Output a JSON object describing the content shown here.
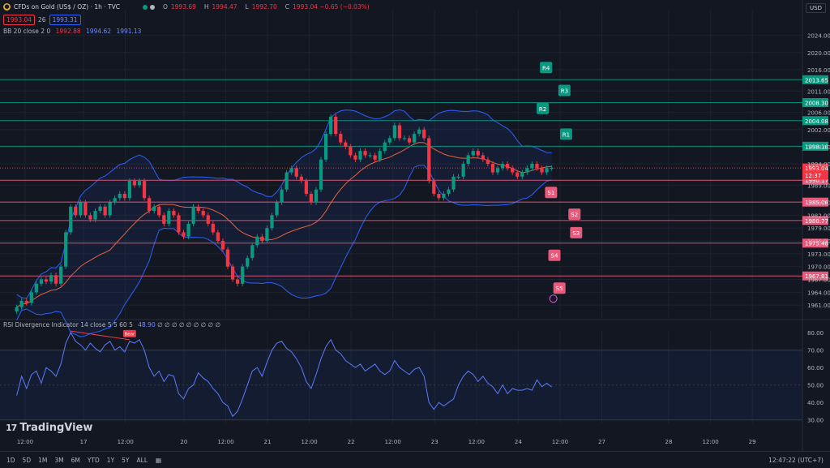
{
  "header": {
    "symbol_title": "CFDs on Gold (US$ / OZ) · 1h · TVC",
    "ohlc": [
      {
        "k": "O",
        "v": "1993.69"
      },
      {
        "k": "H",
        "v": "1994.47"
      },
      {
        "k": "L",
        "v": "1992.70"
      },
      {
        "k": "C",
        "v": "1993.04 −0.65 (−0.03%)"
      }
    ],
    "sell_price": "1993.04",
    "spread": "26",
    "buy_price": "1993.31",
    "bb_label": "BB 20 close 2 0",
    "bb_basis": "1992.88",
    "bb_upper": "1994.62",
    "bb_lower": "1991.13",
    "rsi_label": "RSI Divergence Indicator 14 close 5 5 60 5",
    "rsi_value": "48.90",
    "rsi_tail": "∅ ∅ ∅ ∅ ∅ ∅ ∅ ∅ ∅",
    "currency": "USD"
  },
  "branding": {
    "logo_text": "TradingView",
    "logo_mark": "17"
  },
  "bottom_bar": {
    "ranges": [
      "1D",
      "5D",
      "1M",
      "3M",
      "6M",
      "YTD",
      "1Y",
      "5Y",
      "ALL"
    ],
    "clock": "12:47:22 (UTC+7)"
  },
  "chart_data": {
    "type": "candlestick",
    "title": "CFDs on Gold (US$ / OZ) · 1h · TVC",
    "y_ticks": [
      "2024.00",
      "2020.00",
      "2016.00",
      "2011.00",
      "2006.00",
      "2002.00",
      "1998.00",
      "1994.00",
      "1989.00",
      "1985.00",
      "1982.00",
      "1979.00",
      "1976.00",
      "1973.00",
      "1970.00",
      "1967.00",
      "1964.00",
      "1961.00"
    ],
    "ylim": [
      1958,
      2030
    ],
    "x_tick_labels": [
      "12:00",
      "17",
      "12:00",
      "20",
      "12:00",
      "21",
      "12:00",
      "22",
      "12:00",
      "23",
      "12:00",
      "24",
      "12:00",
      "27",
      "28",
      "12:00",
      "29"
    ],
    "x_tick_positions": [
      0.5,
      4,
      6.5,
      10,
      12.5,
      15,
      17.5,
      20,
      22.5,
      25,
      27.5,
      30,
      32.5,
      35,
      39,
      41.5,
      44
    ],
    "xlim": [
      -1,
      47
    ],
    "last_price": {
      "value": 1993.04,
      "time": "12:37"
    },
    "pivots": [
      {
        "name": "R4",
        "value": 2013.65,
        "color": "#089981"
      },
      {
        "name": "R3",
        "value": 2008.3,
        "color": "#089981"
      },
      {
        "name": "R2",
        "value": 2004.08,
        "color": "#089981"
      },
      {
        "name": "R1",
        "value": 1998.1,
        "color": "#089981"
      },
      {
        "name": "S1",
        "value": 1990.17,
        "color": "#e75a7c"
      },
      {
        "name": "S2",
        "value": 1985.06,
        "color": "#e75a7c"
      },
      {
        "name": "S3",
        "value": 1980.77,
        "color": "#e75a7c"
      },
      {
        "name": "S4",
        "value": 1975.48,
        "color": "#e75a7c"
      },
      {
        "name": "S5",
        "value": 1967.81,
        "color": "#e75a7c"
      }
    ],
    "pivot_label_x": [
      31.3,
      32.4,
      31.1,
      32.5,
      31.6,
      33.0,
      33.1,
      31.8,
      32.1
    ],
    "close": [
      1960.5,
      1962,
      1961.5,
      1964,
      1966,
      1967,
      1966.5,
      1968,
      1966,
      1970,
      1978,
      1984,
      1982,
      1985,
      1982,
      1981,
      1983,
      1984,
      1982,
      1985,
      1986,
      1987,
      1986,
      1990,
      1989,
      1990,
      1986,
      1983,
      1984,
      1982,
      1980,
      1983,
      1982,
      1978,
      1977,
      1980,
      1984,
      1983,
      1982,
      1980,
      1978,
      1976,
      1974,
      1970,
      1967,
      1966,
      1970,
      1972,
      1975,
      1977,
      1976,
      1979,
      1982,
      1985,
      1988,
      1992,
      1993,
      1991,
      1990,
      1987,
      1985,
      1988,
      1995,
      2001,
      2005,
      2001,
      1999,
      1998,
      1996,
      1995,
      1997,
      1996,
      1996,
      1995,
      1997,
      1999,
      2000,
      2003,
      2000,
      2000,
      1999,
      2001,
      2002,
      2000,
      1990,
      1987,
      1986,
      1987,
      1988,
      1991,
      1991,
      1994,
      1996,
      1997,
      1996,
      1995,
      1994,
      1992,
      1993,
      1994,
      1993,
      1992,
      1991,
      1992,
      1993,
      1994,
      1993,
      1992,
      1993,
      1993.04
    ],
    "rsi": {
      "values": [
        44,
        55,
        48,
        56,
        58,
        51,
        60,
        58,
        55,
        62,
        74,
        80,
        75,
        73,
        70,
        74,
        71,
        69,
        73,
        75,
        70,
        72,
        69,
        75,
        74,
        76,
        70,
        60,
        55,
        58,
        52,
        56,
        55,
        45,
        42,
        48,
        50,
        57,
        54,
        52,
        48,
        45,
        40,
        38,
        32,
        35,
        42,
        50,
        58,
        60,
        55,
        63,
        70,
        74,
        75,
        71,
        69,
        65,
        60,
        52,
        48,
        56,
        65,
        72,
        76,
        70,
        68,
        64,
        62,
        60,
        62,
        58,
        60,
        62,
        58,
        56,
        58,
        64,
        60,
        58,
        56,
        59,
        60,
        55,
        40,
        36,
        40,
        38,
        40,
        42,
        50,
        55,
        58,
        56,
        52,
        55,
        51,
        49,
        45,
        50,
        45,
        48,
        47,
        47,
        48,
        47,
        53,
        49,
        51,
        48.9
      ],
      "ylim": [
        28,
        81
      ],
      "y_ticks": [
        "80.00",
        "70.00",
        "60.00",
        "50.00",
        "40.00",
        "30.00"
      ],
      "band": [
        30,
        70
      ]
    },
    "annotations": [
      {
        "text": "Bear",
        "color": "#f23645"
      }
    ],
    "colors": {
      "up": "#089981",
      "down": "#f23645",
      "bb_band": "#2962ff",
      "bb_basis": "#e3643e",
      "rsi_line": "#5b7bff"
    }
  }
}
